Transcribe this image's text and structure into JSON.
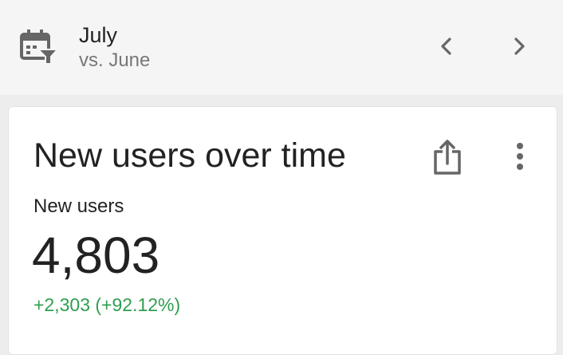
{
  "date_range": {
    "title": "July",
    "comparison": "vs. June"
  },
  "card": {
    "title": "New users over time",
    "metric_label": "New users",
    "metric_value": "4,803",
    "metric_change": "+2,303 (+92.12%)"
  },
  "icons": {
    "calendar": "calendar-filter-icon",
    "prev": "chevron-left-icon",
    "next": "chevron-right-icon",
    "share": "share-icon",
    "more": "more-vert-icon"
  },
  "colors": {
    "positive": "#2e9e4f",
    "icon": "#666666",
    "text_primary": "#222222",
    "text_secondary": "#777777"
  }
}
